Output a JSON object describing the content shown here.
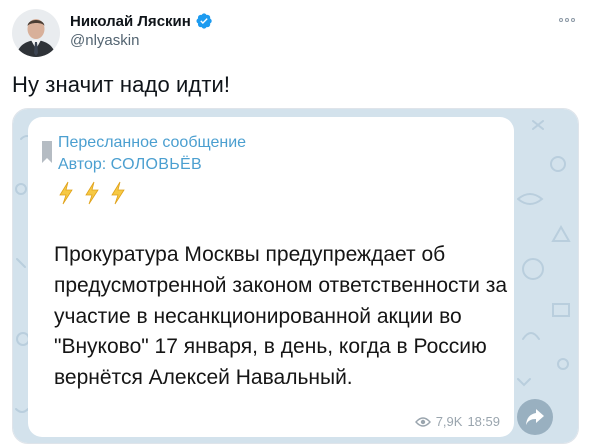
{
  "tweet": {
    "author": {
      "display_name": "Николай Ляскин",
      "handle": "@nlyaskin",
      "verified": true
    },
    "text": "Ну значит надо идти!"
  },
  "telegram_message": {
    "forwarded_label": "Пересланное сообщение",
    "author_prefix": "Автор:",
    "author_name": "СОЛОВЬЁВ",
    "bolts": [
      "⚡",
      "⚡",
      "⚡"
    ],
    "body": "Прокуратура Москвы предупреждает об предусмотренной законом ответственности за участие в несанкционированной акции во \"Внуково\" 17 января, в день, когда в Россию вернётся Алексей Навальный.",
    "views": "7,9K",
    "time": "18:59"
  },
  "colors": {
    "accent": "#4b9fd0",
    "verified_badge": "#1d9bf0",
    "chat_background": "#d3e2ec"
  }
}
